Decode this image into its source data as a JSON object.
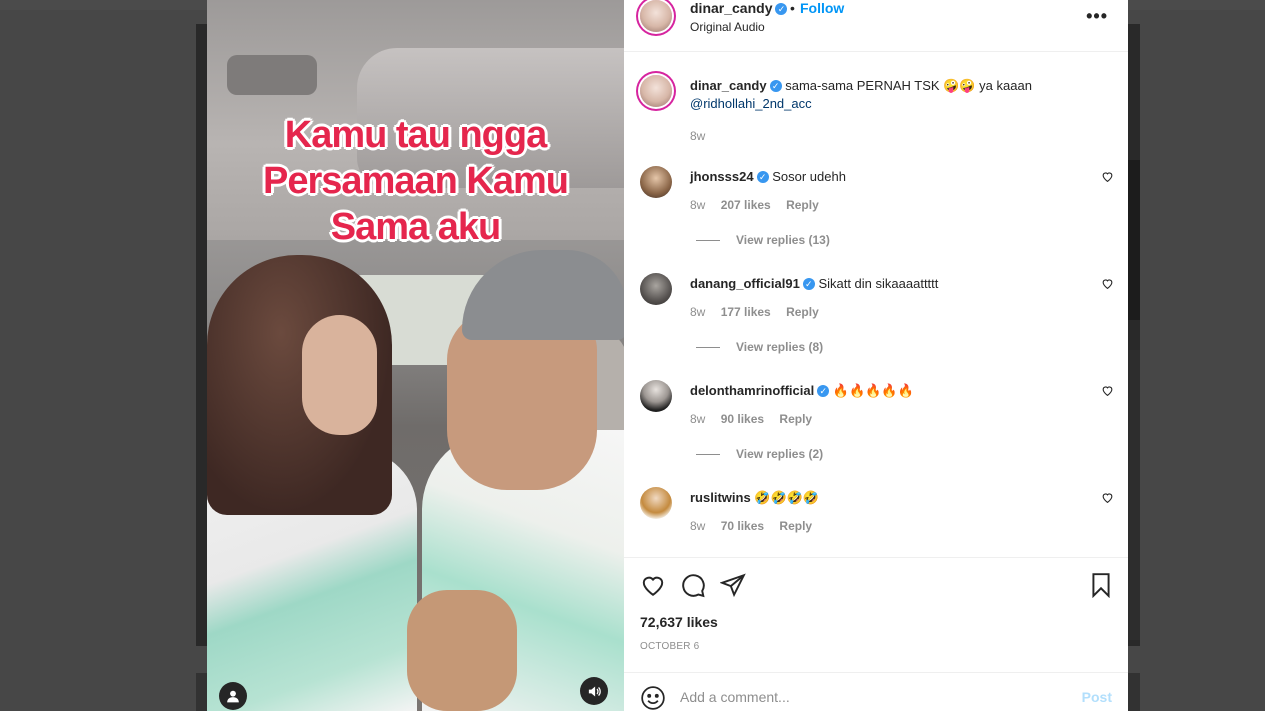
{
  "colors": {
    "accent_follow": "#0095f6",
    "verified": "#3897f0",
    "overlay_text": "#e5264d",
    "post_disabled": "#b2dffc"
  },
  "media": {
    "overlay_lines": [
      "Kamu tau ngga",
      "Persamaan Kamu",
      "Sama aku"
    ],
    "user_tag_icon": "user-icon",
    "sound_icon": "speaker-icon"
  },
  "header": {
    "username": "dinar_candy",
    "dot": "•",
    "follow_label": "Follow",
    "audio": "Original Audio",
    "more_icon": "more-horizontal-icon",
    "more_glyph": "•••"
  },
  "caption": {
    "username": "dinar_candy",
    "text": "sama-sama PERNAH TSK 🤪🤪 ya kaaan",
    "mention": "@ridhollahi_2nd_acc",
    "time": "8w"
  },
  "comments": [
    {
      "username": "jhonsss24",
      "verified": true,
      "text": "Sosor udehh",
      "time": "8w",
      "likes": "207 likes",
      "reply": "Reply",
      "replies": "View replies (13)"
    },
    {
      "username": "danang_official91",
      "verified": true,
      "text": "Sikatt din sikaaaattttt",
      "time": "8w",
      "likes": "177 likes",
      "reply": "Reply",
      "replies": "View replies (8)"
    },
    {
      "username": "delonthamrinofficial",
      "verified": true,
      "text": "🔥🔥🔥🔥🔥",
      "time": "8w",
      "likes": "90 likes",
      "reply": "Reply",
      "replies": "View replies (2)"
    },
    {
      "username": "ruslitwins",
      "verified": false,
      "text": "🤣🤣🤣🤣",
      "time": "8w",
      "likes": "70 likes",
      "reply": "Reply",
      "replies": ""
    }
  ],
  "actions": {
    "likes": "72,637 likes",
    "date": "OCTOBER 6"
  },
  "add_comment": {
    "placeholder": "Add a comment...",
    "post_label": "Post"
  }
}
